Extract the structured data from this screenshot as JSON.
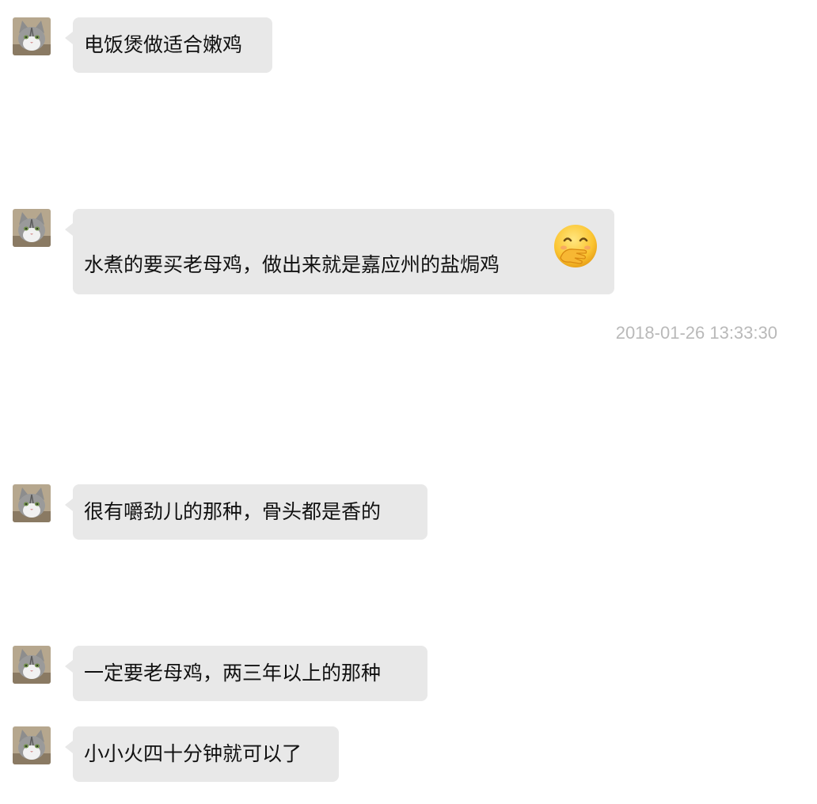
{
  "chat": {
    "messages": [
      {
        "sender": "cat-avatar",
        "text": "电饭煲做适合嫩鸡"
      },
      {
        "sender": "cat-avatar",
        "text": "水煮的要买老母鸡，做出来就是嘉应州的盐焗鸡",
        "emoji": "hand-over-mouth-emoji"
      },
      {
        "sender": "cat-avatar",
        "text": "很有嚼劲儿的那种，骨头都是香的"
      },
      {
        "sender": "cat-avatar",
        "text": "一定要老母鸡，两三年以上的那种"
      },
      {
        "sender": "cat-avatar",
        "text": "小小火四十分钟就可以了"
      }
    ],
    "timestamp": "2018-01-26 13:33:30"
  },
  "colors": {
    "bubble": "#e8e8e8",
    "text": "#111111",
    "timestamp": "#b9b9b9",
    "background": "#ffffff"
  }
}
